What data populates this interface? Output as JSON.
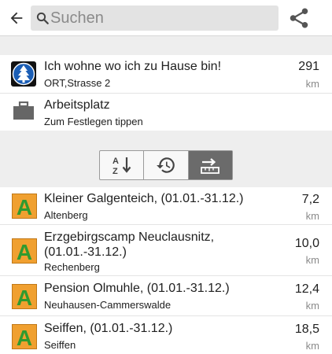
{
  "toolbar": {
    "back_icon": "arrow-left-icon",
    "search_placeholder": "Suchen",
    "share_icon": "share-icon"
  },
  "favorites": [
    {
      "title": "Ich wohne wo ich zu Hause bin!",
      "subtitle": "ORT,Strasse 2",
      "distance": "291",
      "unit": "km",
      "icon": "home-tree-icon"
    },
    {
      "title": "Arbeitsplatz",
      "subtitle": "Zum Festlegen tippen",
      "icon": "briefcase-icon"
    }
  ],
  "sort": {
    "buttons": [
      {
        "icon": "sort-alpha-icon",
        "active": false
      },
      {
        "icon": "history-icon",
        "active": false
      },
      {
        "icon": "sort-distance-icon",
        "active": true
      }
    ]
  },
  "results": [
    {
      "title": "Kleiner Galgenteich, (01.01.-31.12.)",
      "subtitle": "Altenberg",
      "distance": "7,2",
      "unit": "km",
      "icon": "campsite-icon"
    },
    {
      "title": "Erzgebirgscamp Neuclausnitz, (01.01.-31.12.)",
      "subtitle": "Rechenberg",
      "distance": "10,0",
      "unit": "km",
      "icon": "campsite-icon"
    },
    {
      "title": "Pension Olmuhle, (01.01.-31.12.)",
      "subtitle": "Neuhausen-Cammerswalde",
      "distance": "12,4",
      "unit": "km",
      "icon": "campsite-icon"
    },
    {
      "title": "Seiffen, (01.01.-31.12.)",
      "subtitle": "Seiffen",
      "distance": "18,5",
      "unit": "km",
      "icon": "campsite-icon"
    }
  ],
  "colors": {
    "campsite_bg": "#f0a030",
    "campsite_letter": "#2f9a2f",
    "home_bg": "#1b5eb5",
    "active_sort": "#6b6b6b"
  }
}
